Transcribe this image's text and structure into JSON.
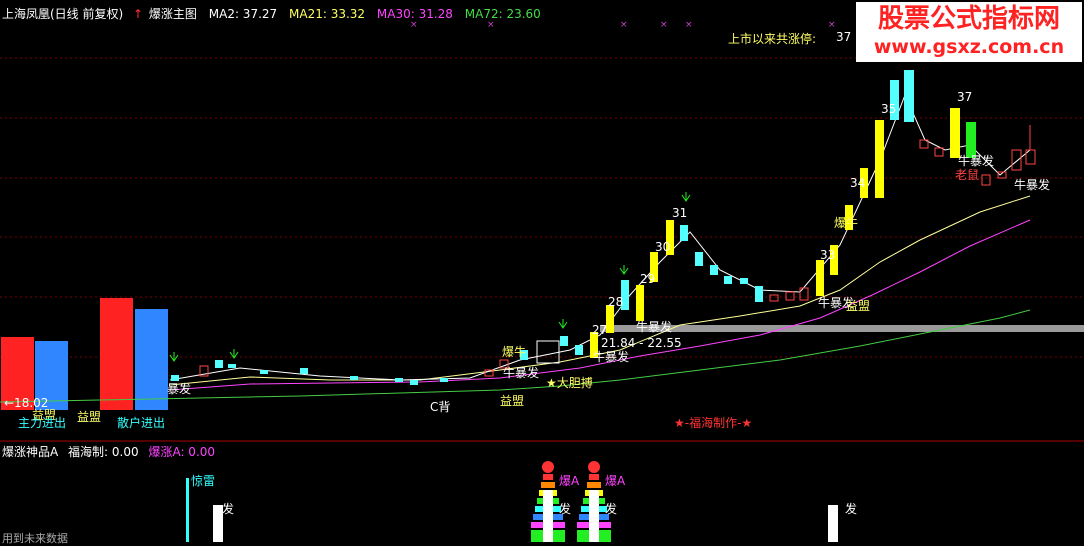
{
  "header": {
    "stock": "上海凤凰(日线 前复权)",
    "arrow": "↑",
    "indicator": "爆涨主图",
    "ma2": "MA2: 37.27",
    "ma21": "MA21: 33.32",
    "ma30": "MA30: 31.28",
    "ma72": "MA72: 23.60"
  },
  "limit_up": {
    "label": "上市以来共涨停:",
    "value": "37"
  },
  "watermark": {
    "line1": "股票公式指标网",
    "line2": "www.gsxz.com.cn"
  },
  "sub_header": {
    "name": "爆涨神品A",
    "fuhai": "福海制: 0.00",
    "baozhang": "爆涨A: 0.00"
  },
  "price_range": "21.84 - 22.55",
  "credit": "★-福海制作-★",
  "footer_note": "用到未来数据",
  "labels": {
    "n18": "←18.02",
    "yimeng": "益盟",
    "zhulijinchu": "主力进出",
    "sanhu": "散户进出",
    "c_bei": "C背",
    "baofa": "暴发",
    "niubaofa": "牛暴发",
    "baoniu": "爆牛",
    "dadanbo": "★大胆搏",
    "laoyou": "老鼠",
    "jinglei": "惊雷",
    "fa": "发",
    "baoa": "爆A",
    "n27": "27",
    "n28": "28",
    "n29": "29",
    "n30": "30",
    "n31": "31",
    "n34": "34",
    "n35": "35",
    "n36": "36",
    "n37": "37",
    "n33": "33"
  },
  "colors": {
    "up": "#ff4444",
    "down": "#54ffff",
    "limit": "#ffff00",
    "ma21": "#ffff80",
    "ma30": "#ff44ff",
    "ma72": "#44cc44",
    "grid": "#880000"
  }
}
